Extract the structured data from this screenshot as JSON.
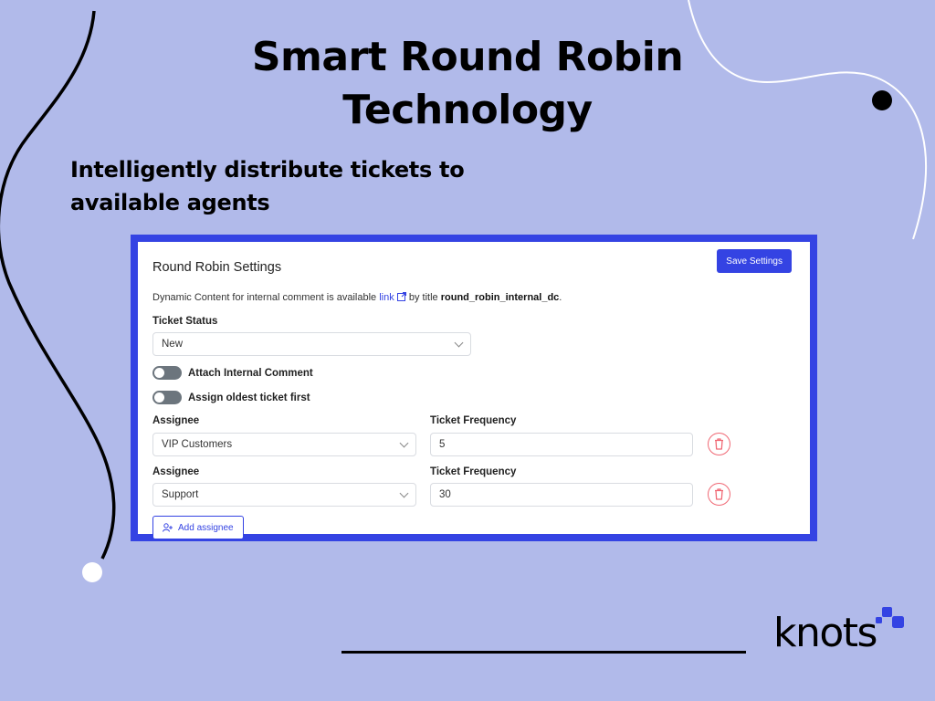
{
  "slide": {
    "title_line1": "Smart Round Robin",
    "title_line2": "Technology",
    "subtitle_line1": "Intelligently distribute tickets to",
    "subtitle_line2": "available agents",
    "brand_logo_text": "knots",
    "colors": {
      "background": "#b1baea",
      "accent": "#3443e3",
      "danger": "#f06874",
      "toggle_off": "#6c757d"
    }
  },
  "settings": {
    "title": "Round Robin Settings",
    "save_label": "Save Settings",
    "info_prefix": "Dynamic Content for internal comment is available ",
    "info_link": "link",
    "info_middle": " by title ",
    "info_code": "round_robin_internal_dc",
    "info_suffix": ".",
    "ticket_status_label": "Ticket Status",
    "ticket_status_value": "New",
    "toggles": [
      {
        "label": "Attach Internal Comment",
        "on": false
      },
      {
        "label": "Assign oldest ticket first",
        "on": false
      }
    ],
    "assignees": [
      {
        "assignee_label": "Assignee",
        "assignee_value": "VIP Customers",
        "frequency_label": "Ticket Frequency",
        "frequency_value": "5"
      },
      {
        "assignee_label": "Assignee",
        "assignee_value": "Support",
        "frequency_label": "Ticket Frequency",
        "frequency_value": "30"
      }
    ],
    "add_assignee_label": "Add assignee",
    "icons": {
      "external_link": "external-link-icon",
      "trash": "trash-icon",
      "add_user": "add-user-icon",
      "chevron": "chevron-down-icon"
    }
  }
}
